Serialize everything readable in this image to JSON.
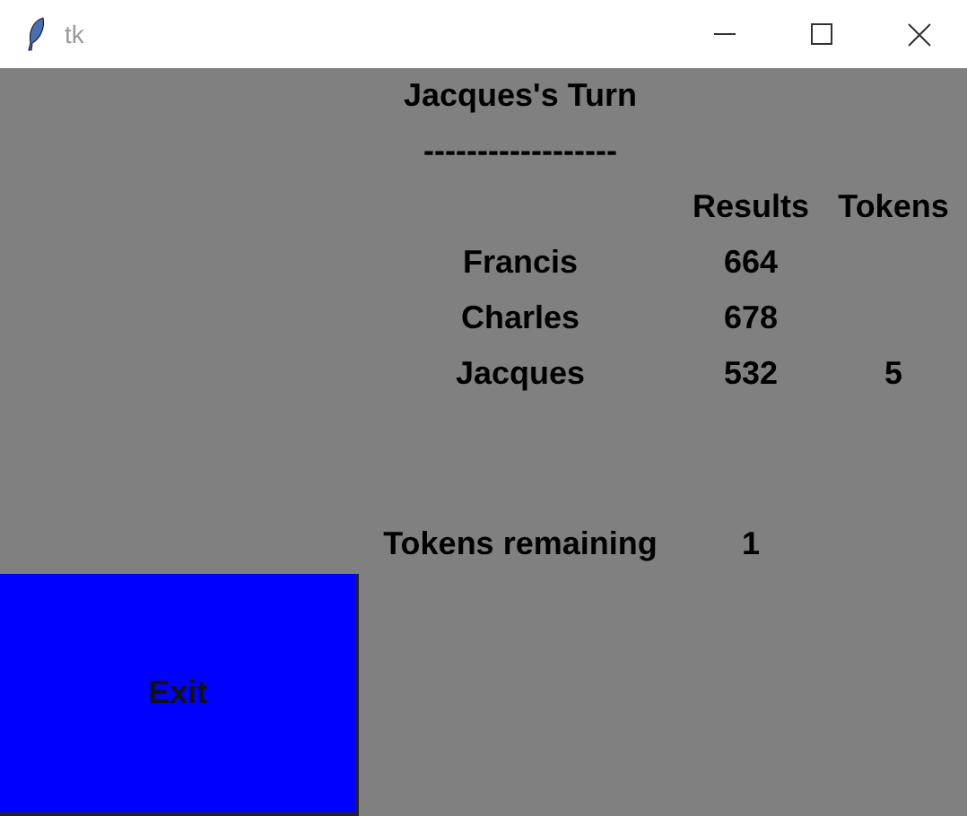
{
  "window": {
    "title": "tk"
  },
  "heading": "Jacques's Turn",
  "separator": "------------------",
  "columns": [
    "Results",
    "Tokens"
  ],
  "players": [
    {
      "name": "Francis",
      "result": "664"
    },
    {
      "name": "Charles",
      "result": "678"
    },
    {
      "name": "Jacques",
      "result": "532",
      "tokens": "5"
    }
  ],
  "tokens_remaining": {
    "label": "Tokens remaining",
    "value": "1"
  },
  "exit_button": {
    "label": "Exit"
  }
}
